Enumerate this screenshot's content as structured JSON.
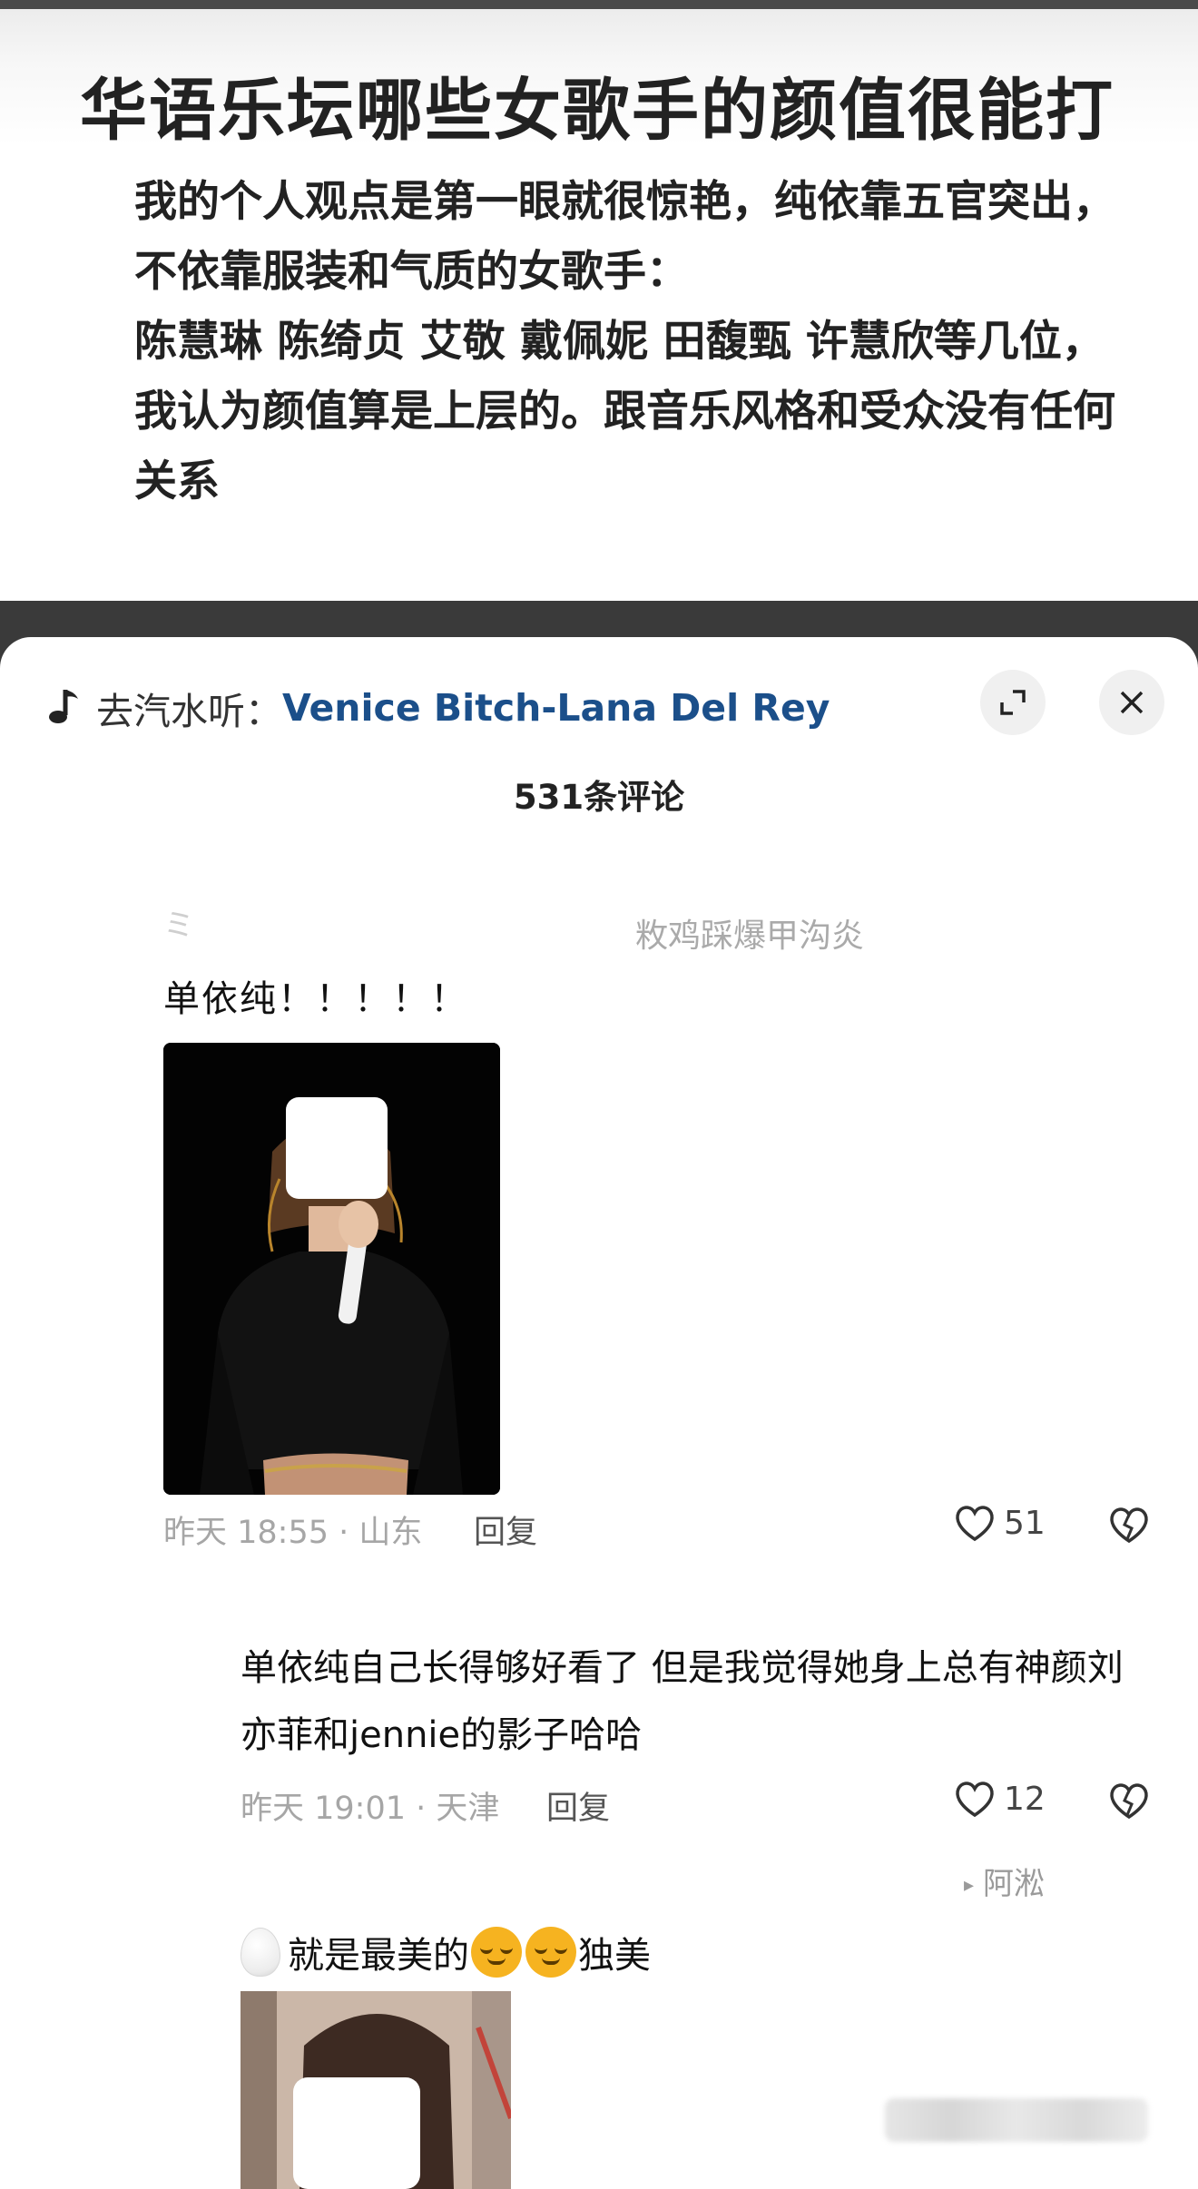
{
  "article": {
    "title": "华语乐坛哪些女歌手的颜值很能打",
    "paragraph1": "我的个人观点是第一眼就很惊艳，纯依靠五官突出，不依靠服装和气质的女歌手：",
    "paragraph2": "陈慧琳 陈绮贞 艾敬 戴佩妮 田馥甄 许慧欣等几位，我认为颜值算是上层的。跟音乐风格和受众没有任何关系"
  },
  "music_bar": {
    "prefix": "去汽水听：",
    "song": "Venice Bitch-Lana Del Rey",
    "icon": "music-note-icon"
  },
  "sheet": {
    "comment_count": "531条评论",
    "expand_icon": "expand-icon",
    "close_icon": "close-icon"
  },
  "comments": [
    {
      "faded_prefix": "ミ",
      "username_partial": "敉鸡踩爆甲沟炎",
      "text": "单依纯！！！！！",
      "time_location": "昨天 18:55 · 山东",
      "reply_label": "回复",
      "likes": "51"
    },
    {
      "text": "单依纯自己长得够好看了 但是我觉得她身上总有神颜刘亦菲和jennie的影子哈哈",
      "time_location": "昨天 19:01 · 天津",
      "reply_label": "回复",
      "likes": "12"
    },
    {
      "reply_to": "阿淞",
      "text_a": "就是最美的",
      "text_b": "独美"
    }
  ],
  "colors": {
    "link_blue": "#1b4f8a",
    "meta_gray": "#a6a6a6",
    "top_bar": "#4a4a4a"
  }
}
